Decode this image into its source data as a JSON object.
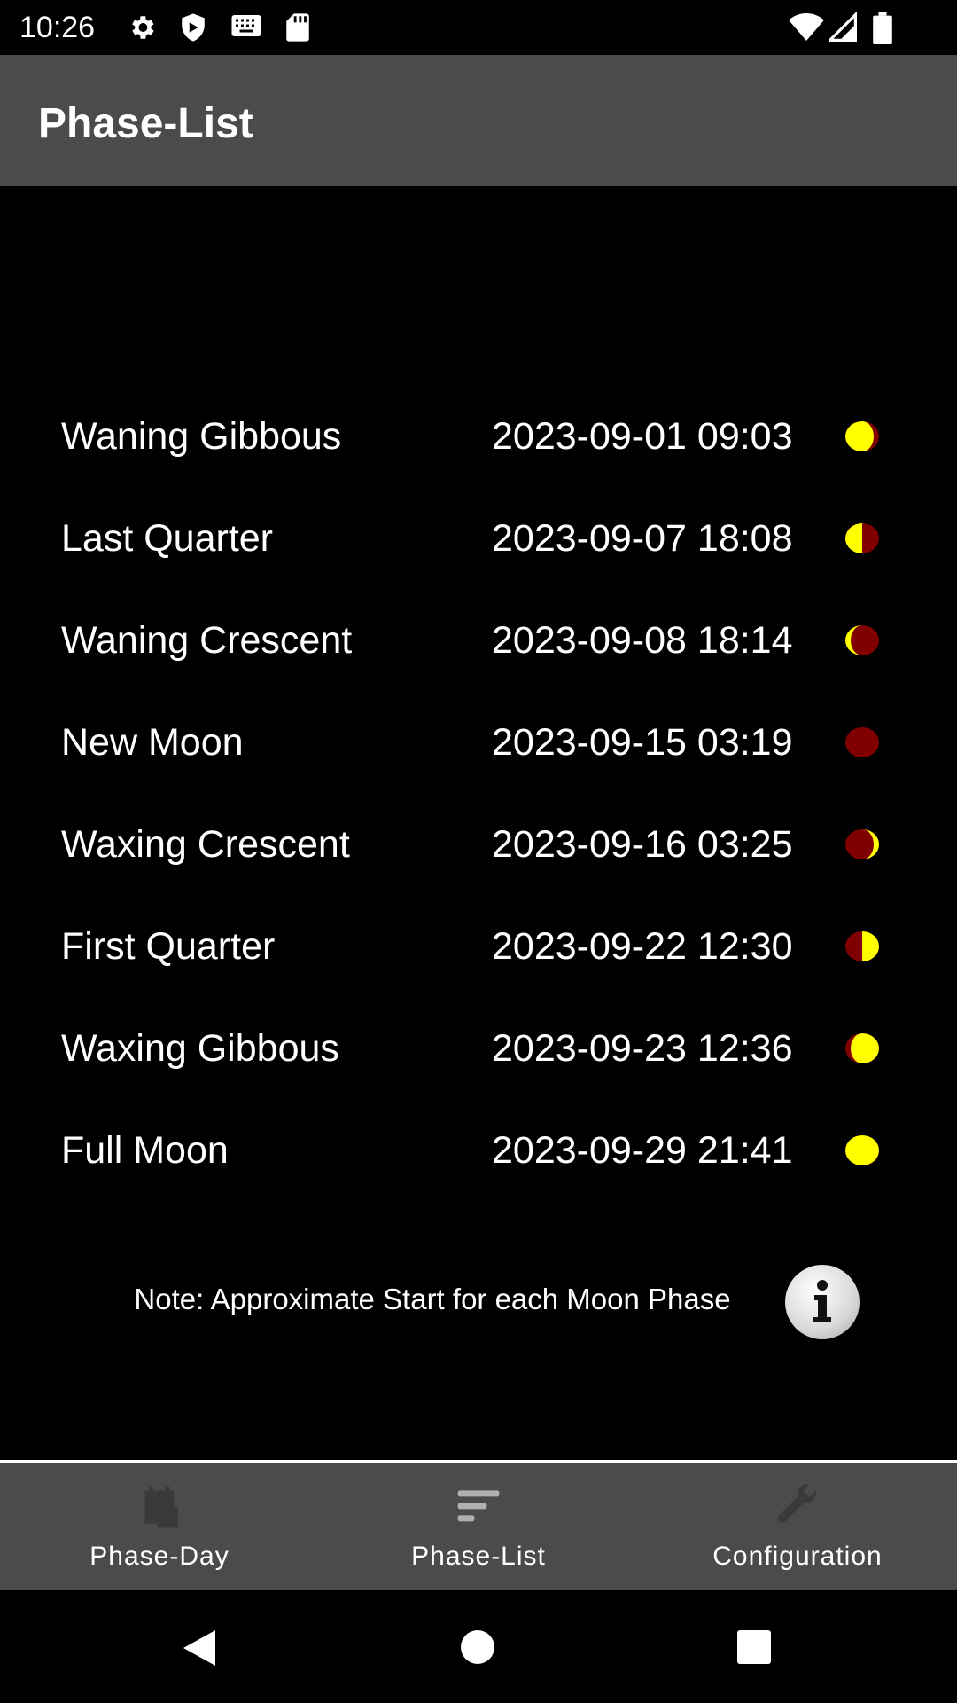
{
  "status_bar": {
    "time": "10:26",
    "icons": [
      "gear-icon",
      "shield-icon",
      "keyboard-icon",
      "sd-card-icon",
      "wifi-icon",
      "signal-icon",
      "battery-icon"
    ]
  },
  "app_bar": {
    "title": "Phase-List"
  },
  "phases": [
    {
      "name": "Waning Gibbous",
      "date": "2023-09-01 09:03",
      "icon": "waning-gibbous"
    },
    {
      "name": "Last Quarter",
      "date": "2023-09-07 18:08",
      "icon": "last-quarter"
    },
    {
      "name": "Waning Crescent",
      "date": "2023-09-08 18:14",
      "icon": "waning-crescent"
    },
    {
      "name": "New Moon",
      "date": "2023-09-15 03:19",
      "icon": "new-moon"
    },
    {
      "name": "Waxing Crescent",
      "date": "2023-09-16 03:25",
      "icon": "waxing-crescent"
    },
    {
      "name": "First Quarter",
      "date": "2023-09-22 12:30",
      "icon": "first-quarter"
    },
    {
      "name": "Waxing Gibbous",
      "date": "2023-09-23 12:36",
      "icon": "waxing-gibbous"
    },
    {
      "name": "Full Moon",
      "date": "2023-09-29 21:41",
      "icon": "full-moon"
    }
  ],
  "note": "Note: Approximate Start for each Moon Phase",
  "colors": {
    "lit": "#ffff00",
    "dark": "#800000",
    "bar": "#4a4b4d"
  },
  "bottom_nav": [
    {
      "label": "Phase-Day",
      "icon": "calendar-icon",
      "active": false
    },
    {
      "label": "Phase-List",
      "icon": "list-icon",
      "active": true
    },
    {
      "label": "Configuration",
      "icon": "wrench-icon",
      "active": false
    }
  ]
}
